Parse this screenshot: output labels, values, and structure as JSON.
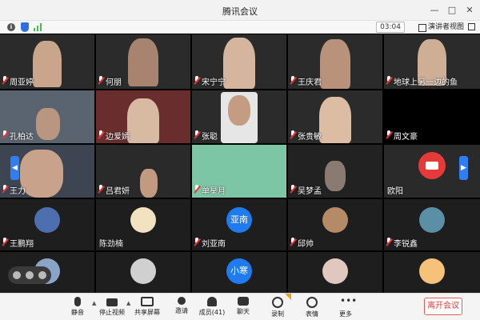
{
  "window": {
    "title": "腾讯会议"
  },
  "infobar": {
    "timer": "03:04",
    "speaker_view": "演讲者视图"
  },
  "participants": [
    {
      "name": "周亚婷"
    },
    {
      "name": "何朋"
    },
    {
      "name": "宋宁宁"
    },
    {
      "name": "王庆君"
    },
    {
      "name": "地球上另一边的鱼"
    },
    {
      "name": "孔柏达"
    },
    {
      "name": "边爱嫣"
    },
    {
      "name": "张聪"
    },
    {
      "name": "张贵敏"
    },
    {
      "name": "周文豪"
    },
    {
      "name": "王力"
    },
    {
      "name": "吕君妍"
    },
    {
      "name": "单星月"
    },
    {
      "name": "吴梦孟"
    },
    {
      "name": "欧阳"
    },
    {
      "name": "王鹏翔"
    },
    {
      "name": "陈劲楠"
    },
    {
      "name": "刘亚南"
    },
    {
      "name": "邱帅"
    },
    {
      "name": "李锐鑫"
    }
  ],
  "avatars": {
    "yanan": "亚南",
    "xiaohan": "小寒"
  },
  "toolbar": {
    "mute": "静音",
    "stop_video": "停止视频",
    "share_screen": "共享屏幕",
    "invite": "邀请",
    "members": "成员(41)",
    "chat": "聊天",
    "record": "录制",
    "reactions": "表情",
    "more": "更多",
    "leave": "离开会议"
  },
  "colors": {
    "accent": "#1f7cf0",
    "danger": "#e53a3a",
    "active_speaker": "#2f7ff0"
  }
}
